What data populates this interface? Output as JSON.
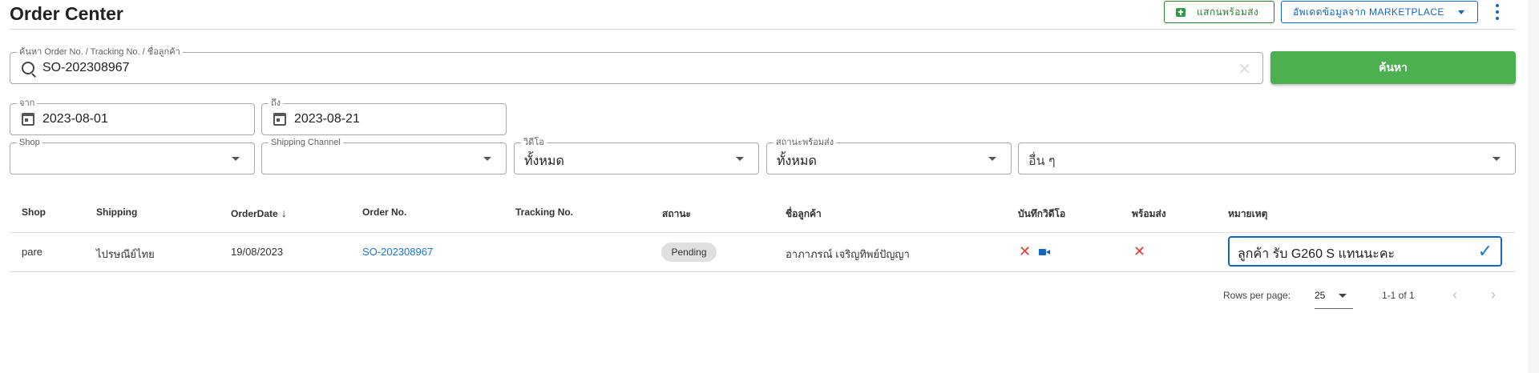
{
  "page": {
    "title": "Order Center"
  },
  "header": {
    "scan_label": "แสกนพร้อมส่ง",
    "update_label": "อัพเดตข้อมูลจาก MARKETPLACE"
  },
  "search": {
    "legend": "ค้นหา Order No. / Tracking No. / ชื่อลูกค้า",
    "value": "SO-202308967",
    "clear": "✕",
    "button_label": "ค้นหา"
  },
  "dates": {
    "from_legend": "จาก",
    "from_value": "2023-08-01",
    "to_legend": "ถึง",
    "to_value": "2023-08-21"
  },
  "filters": {
    "shop_legend": "Shop",
    "shop_value": "",
    "shipping_legend": "Shipping Channel",
    "shipping_value": "",
    "video_legend": "วิดีโอ",
    "video_value": "ทั้งหมด",
    "ready_legend": "สถานะพร้อมส่ง",
    "ready_value": "ทั้งหมด",
    "other_value": "อื่น ๆ"
  },
  "table": {
    "headers": [
      "Shop",
      "Shipping",
      "OrderDate",
      "Order No.",
      "Tracking No.",
      "สถานะ",
      "ชื่อลูกค้า",
      "บันทึกวิดีโอ",
      "พร้อมส่ง",
      "หมายเหตุ"
    ],
    "rows": [
      {
        "shop": "pare",
        "shipping": "ไปรษณีย์ไทย",
        "order_date": "19/08/2023",
        "order_no": "SO-202308967",
        "tracking_no": "",
        "status": "Pending",
        "customer": "อาภาภรณ์ เจริญทิพย์ปัญญา",
        "note": "ลูกค้า รับ G260 S แทนนะคะ"
      }
    ]
  },
  "pagination": {
    "rows_per_page_label": "Rows per page:",
    "rows_per_page": "25",
    "range": "1-1 of 1"
  },
  "icons": {
    "x": "✕",
    "check": "✓",
    "prev": "‹",
    "next": "›"
  },
  "colors": {
    "primary_green": "#4caf50",
    "primary_blue": "#1565c0",
    "error_red": "#e53935"
  }
}
